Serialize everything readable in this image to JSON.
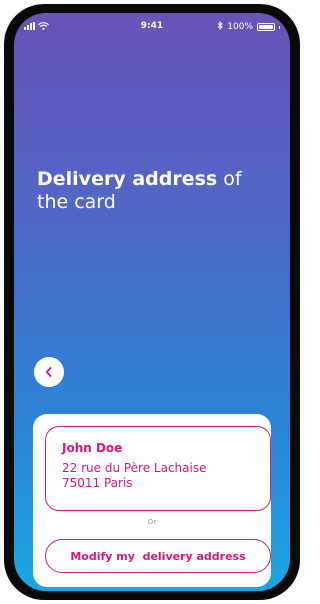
{
  "status_bar": {
    "time": "9:41",
    "battery": "100%",
    "icons": [
      "signal-icon",
      "wifi-icon",
      "bluetooth-icon",
      "battery-icon"
    ]
  },
  "headline": {
    "bold": "Delivery address",
    "rest": " of the card"
  },
  "back_button": {
    "icon": "chevron-left-icon"
  },
  "address": {
    "name": "John Doe",
    "line1": "22 rue du Père Lachaise",
    "line2": "75011 Paris"
  },
  "separator": "Or",
  "modify_button": {
    "label": "Modify my  delivery address"
  },
  "colors": {
    "accent": "#e0157a",
    "gradient_top": "#6a53b8",
    "gradient_bottom": "#1aa6e3",
    "card_bg": "#ffffff"
  }
}
